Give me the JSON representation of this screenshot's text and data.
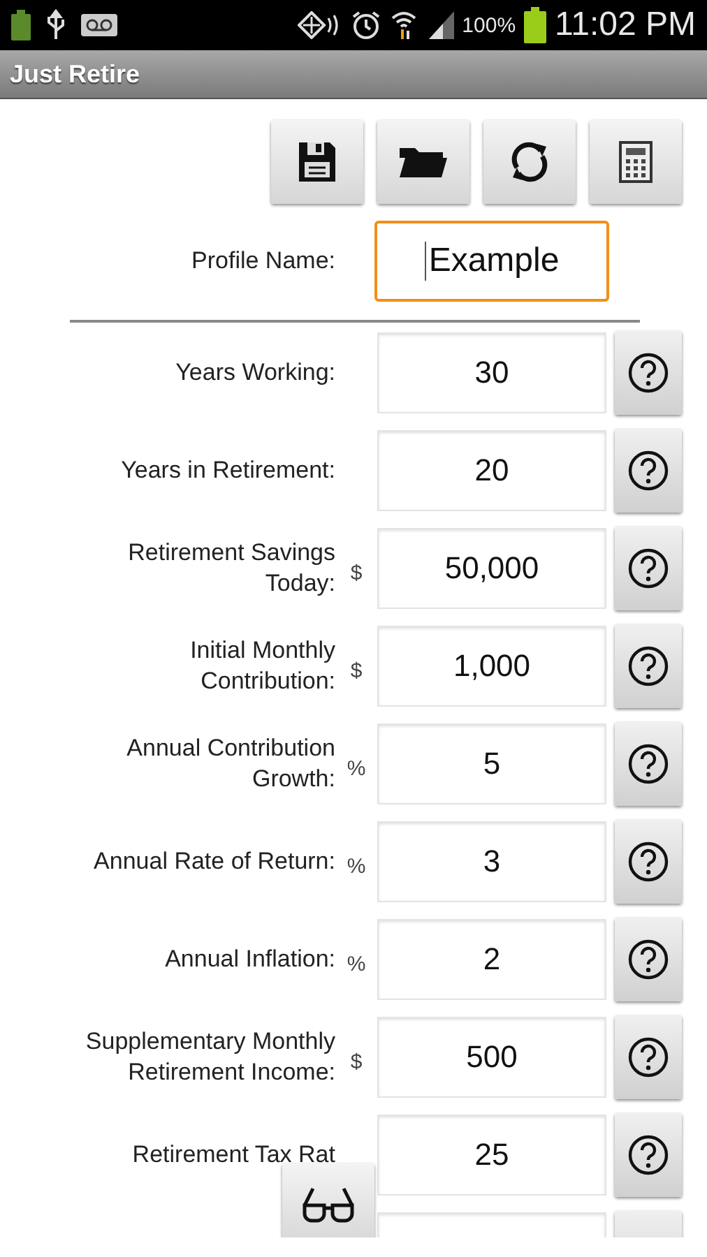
{
  "status_bar": {
    "battery_percent": "100%",
    "time": "11:02 PM"
  },
  "app_bar": {
    "title": "Just Retire"
  },
  "toolbar": [
    {
      "kind": "save"
    },
    {
      "kind": "open"
    },
    {
      "kind": "refresh"
    },
    {
      "kind": "calculator"
    }
  ],
  "profile": {
    "label": "Profile Name:",
    "value": "Example",
    "focused": true
  },
  "rows": [
    {
      "label_lines": [
        "Years Working:"
      ],
      "value": "30"
    },
    {
      "label_lines": [
        "Years in Retirement:"
      ],
      "value": "20"
    },
    {
      "label_lines": [
        "Retirement Savings",
        "Today:"
      ],
      "unit": "$",
      "value": "50,000"
    },
    {
      "label_lines": [
        "Initial Monthly",
        "Contribution:"
      ],
      "unit": "$",
      "value": "1,000"
    },
    {
      "label_lines": [
        "Annual Contribution",
        "Growth:"
      ],
      "unit": "%",
      "value": "5"
    },
    {
      "label_lines": [
        "Annual Rate of Return:"
      ],
      "unit": "%",
      "value": "3"
    },
    {
      "label_lines": [
        "Annual Inflation:"
      ],
      "unit": "%",
      "value": "2"
    },
    {
      "label_lines": [
        "Supplementary Monthly",
        "Retirement Income:"
      ],
      "unit": "$",
      "value": "500"
    },
    {
      "label_lines": [
        "Retirement Tax Rat"
      ],
      "value": "25"
    },
    {
      "kind": "cut"
    }
  ],
  "overlay_button": {
    "kind": "glasses"
  }
}
